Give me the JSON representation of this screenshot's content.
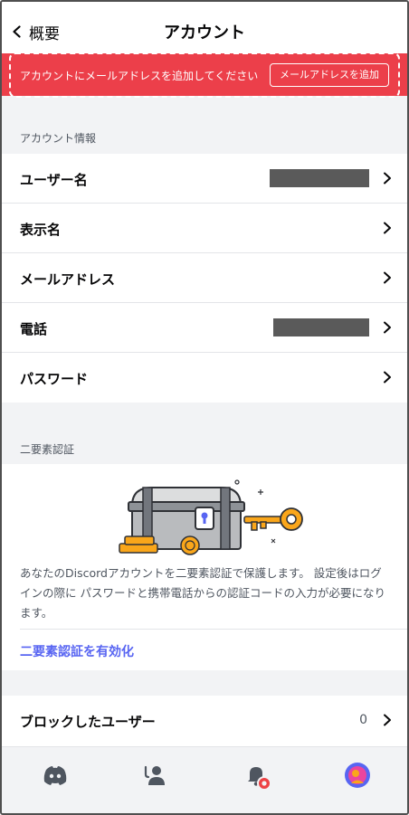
{
  "header": {
    "back_label": "概要",
    "title": "アカウント"
  },
  "banner": {
    "message": "アカウントにメールアドレスを追加してください",
    "button_label": "メールアドレスを追加",
    "color": "#ec3f4a"
  },
  "account_info": {
    "section_title": "アカウント情報",
    "rows": [
      {
        "label": "ユーザー名",
        "value_redacted": true
      },
      {
        "label": "表示名"
      },
      {
        "label": "メールアドレス"
      },
      {
        "label": "電話",
        "value_redacted": true
      },
      {
        "label": "パスワード"
      }
    ]
  },
  "two_factor": {
    "section_title": "二要素認証",
    "description": "あなたのDiscordアカウントを二要素認証で保護します。 設定後はログインの際に パスワードと携帯電話からの認証コードの入力が必要になります。",
    "enable_link": "二要素認証を有効化",
    "link_color": "#5865f2"
  },
  "blocked": {
    "label": "ブロックしたユーザー",
    "count": "0"
  },
  "tabbar": {
    "items": [
      "discord-icon",
      "friends-icon",
      "notifications-icon",
      "avatar"
    ],
    "badge_color": "#ed4245"
  }
}
